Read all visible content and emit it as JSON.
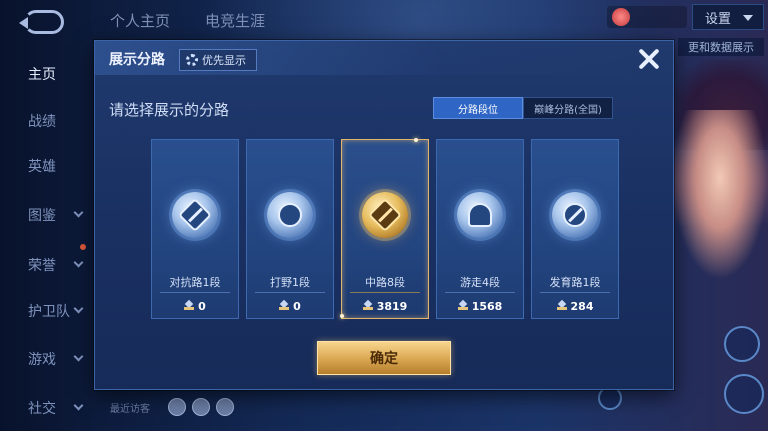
{
  "background": {
    "nav_items": [
      {
        "label": "主页",
        "has_chevron": false,
        "active": true
      },
      {
        "label": "战绩",
        "has_chevron": false,
        "active": false
      },
      {
        "label": "英雄",
        "has_chevron": false,
        "active": false
      },
      {
        "label": "图鉴",
        "has_chevron": true,
        "active": false
      },
      {
        "label": "荣誉",
        "has_chevron": true,
        "active": false
      },
      {
        "label": "护卫队",
        "has_chevron": true,
        "active": false
      },
      {
        "label": "游戏",
        "has_chevron": true,
        "active": false
      },
      {
        "label": "社交",
        "has_chevron": true,
        "active": false
      }
    ],
    "top_tabs": [
      "个人主页",
      "电竞生涯"
    ],
    "settings_label": "设置",
    "side_pill": "更和数据展示",
    "bottom_text": "最近访客"
  },
  "modal": {
    "title": "展示分路",
    "priority_label": "优先显示",
    "prompt": "请选择展示的分路",
    "segments": {
      "active": "分路段位",
      "inactive": "巅峰分路(全国)"
    },
    "lanes": [
      {
        "name": "对抗路1段",
        "score": "0",
        "selected": false,
        "icon": "clash-lane-icon"
      },
      {
        "name": "打野1段",
        "score": "0",
        "selected": false,
        "icon": "jungle-icon"
      },
      {
        "name": "中路8段",
        "score": "3819",
        "selected": true,
        "icon": "mid-lane-icon"
      },
      {
        "name": "游走4段",
        "score": "1568",
        "selected": false,
        "icon": "roam-icon"
      },
      {
        "name": "发育路1段",
        "score": "284",
        "selected": false,
        "icon": "farm-lane-icon"
      }
    ],
    "confirm_label": "确定"
  },
  "colors": {
    "accent_gold": "#dcaa55",
    "accent_blue": "#2f66c6",
    "panel": "#1a3163"
  }
}
